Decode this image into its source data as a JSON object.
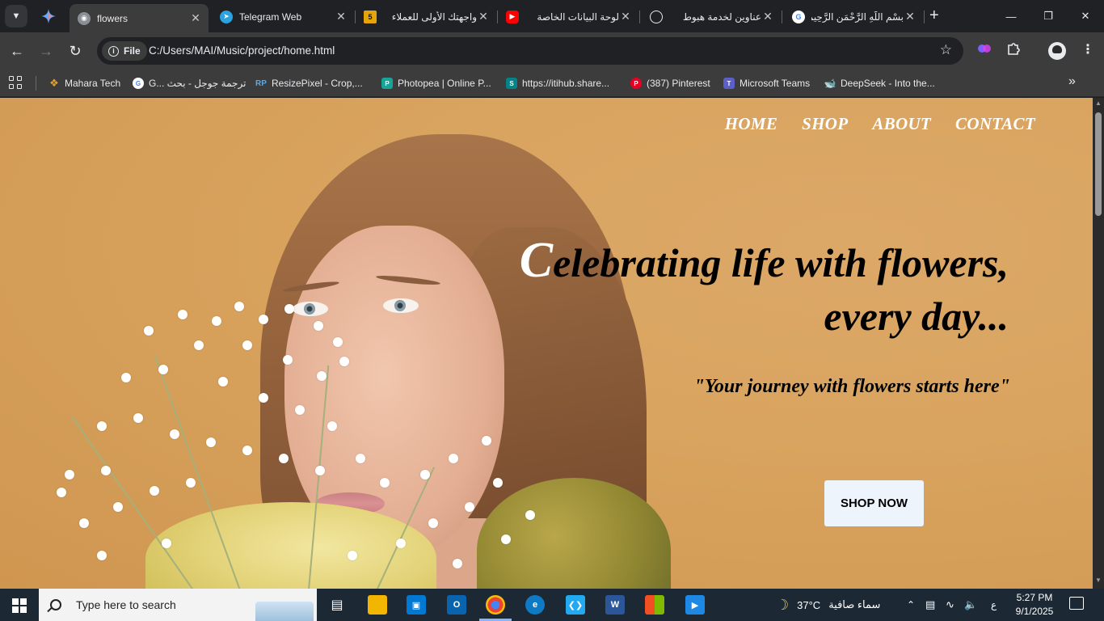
{
  "browser": {
    "tabs": [
      {
        "title": "flowers",
        "active": true
      },
      {
        "title": "Telegram Web"
      },
      {
        "title": "واجهتك الأولى للعملاء"
      },
      {
        "title": "لوحة البيانات الخاصة"
      },
      {
        "title": "عناوين لخدمة هبوط"
      },
      {
        "title": "بسْمِ اللّهِ الرَّحْمَنِ الرَّحِيم"
      }
    ],
    "new_tab_label": "+",
    "tab_badge_5": "5",
    "site_chip": "File",
    "url": "C:/Users/MAI/Music/project/home.html",
    "colors": {
      "tabstrip": "#202124",
      "toolbar": "#3c3c3c"
    }
  },
  "bookmarks": [
    {
      "label": "Mahara Tech"
    },
    {
      "label": "G... ترجمة جوجل - بحث"
    },
    {
      "label": "ResizePixel - Crop,..."
    },
    {
      "label": "Photopea | Online P..."
    },
    {
      "label": "https://itihub.share..."
    },
    {
      "label": "(387) Pinterest"
    },
    {
      "label": "Microsoft Teams"
    },
    {
      "label": "DeepSeek - Into the..."
    }
  ],
  "page": {
    "nav": [
      "HOME",
      "SHOP",
      "ABOUT",
      "CONTACT"
    ],
    "hero_first_letter": "C",
    "hero_line1_rest": "elebrating life with flowers,",
    "hero_line2": "every day...",
    "subtitle": "\"Your journey with flowers starts here\"",
    "cta": "SHOP NOW",
    "colors": {
      "background": "#d9a45f",
      "cta_bg": "#eef4fb",
      "nav_text": "#ffffff"
    }
  },
  "taskbar": {
    "search_placeholder": "Type here to search",
    "weather_temp": "37°C",
    "weather_text": "سماء صافية",
    "ime": "ع",
    "time": "5:27 PM",
    "date": "9/1/2025"
  }
}
